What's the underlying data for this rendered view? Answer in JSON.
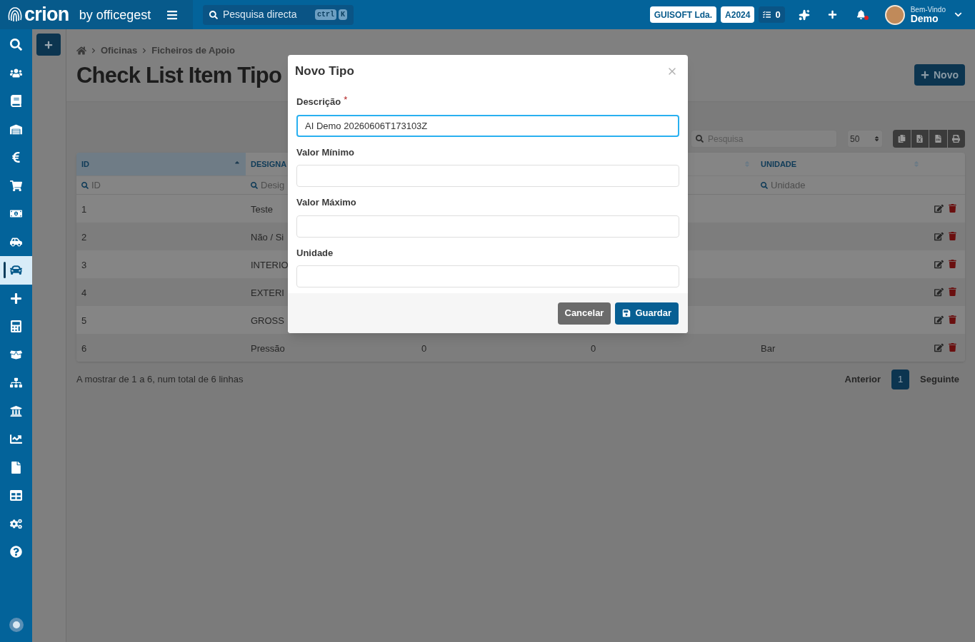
{
  "header": {
    "brand": {
      "name": "crion",
      "tagline": "by officegest"
    },
    "search": {
      "placeholder": "Pesquisa directa",
      "keys": [
        "ctrl",
        "K"
      ]
    },
    "company": "GUISOFT Lda.",
    "year": "A2024",
    "tasks": "0",
    "notifications_unread": true,
    "user": {
      "greeting": "Bem-Vindo",
      "name": "Demo"
    }
  },
  "sidebar": {
    "items": [
      {
        "selected": false
      },
      {
        "selected": false
      },
      {
        "selected": false
      },
      {
        "selected": false
      },
      {
        "selected": false
      },
      {
        "selected": false
      },
      {
        "selected": false
      },
      {
        "selected": false
      },
      {
        "selected": true
      },
      {
        "selected": false
      },
      {
        "selected": false
      },
      {
        "selected": false
      },
      {
        "selected": false
      },
      {
        "selected": false
      },
      {
        "selected": false
      },
      {
        "selected": false
      },
      {
        "selected": false
      },
      {
        "selected": false
      },
      {
        "selected": false
      }
    ]
  },
  "breadcrumb": [
    "Oficinas",
    "Ficheiros de Apoio"
  ],
  "page_title": "Check List Item Tipo",
  "new_button": "Novo",
  "toolbar": {
    "search_placeholder": "Pesquisa",
    "page_size": "50"
  },
  "table": {
    "columns": [
      {
        "kind": "header",
        "label": "ID",
        "filter_placeholder": "ID",
        "sorted": true
      },
      {
        "kind": "header",
        "label": "DESIGNA",
        "filter_placeholder": "Desig"
      },
      {
        "kind": "covered"
      },
      {
        "kind": "sort_only",
        "sorted": false
      },
      {
        "kind": "header",
        "label": "UNIDADE",
        "filter_placeholder": "Unidade",
        "sorted": false
      }
    ],
    "rows": [
      {
        "cells": [
          "1",
          "Teste"
        ]
      },
      {
        "cells": [
          "2",
          "Não / Si"
        ]
      },
      {
        "cells": [
          "3",
          "INTERIO"
        ]
      },
      {
        "cells": [
          "4",
          "EXTERI"
        ]
      },
      {
        "cells": [
          "5",
          "GROSS"
        ]
      },
      {
        "cells": [
          "6",
          "Pressão",
          "0",
          "0",
          "Bar"
        ]
      }
    ]
  },
  "summary": "A mostrar de 1 a 6, num total de 6 linhas",
  "pagination": {
    "previous": "Anterior",
    "pages": [
      {
        "label": "1",
        "selected": true
      }
    ],
    "next": "Seguinte"
  },
  "dialog": {
    "title": "Novo Tipo",
    "fields": [
      {
        "label": "Descrição",
        "required_mark": "*",
        "value": "AI Demo 20260606T173103Z",
        "focused": true
      },
      {
        "label": "Valor Mínimo",
        "focused": false
      },
      {
        "label": "Valor Máximo",
        "focused": false
      },
      {
        "label": "Unidade",
        "focused": false
      }
    ],
    "cancel": "Cancelar",
    "save": "Guardar"
  }
}
